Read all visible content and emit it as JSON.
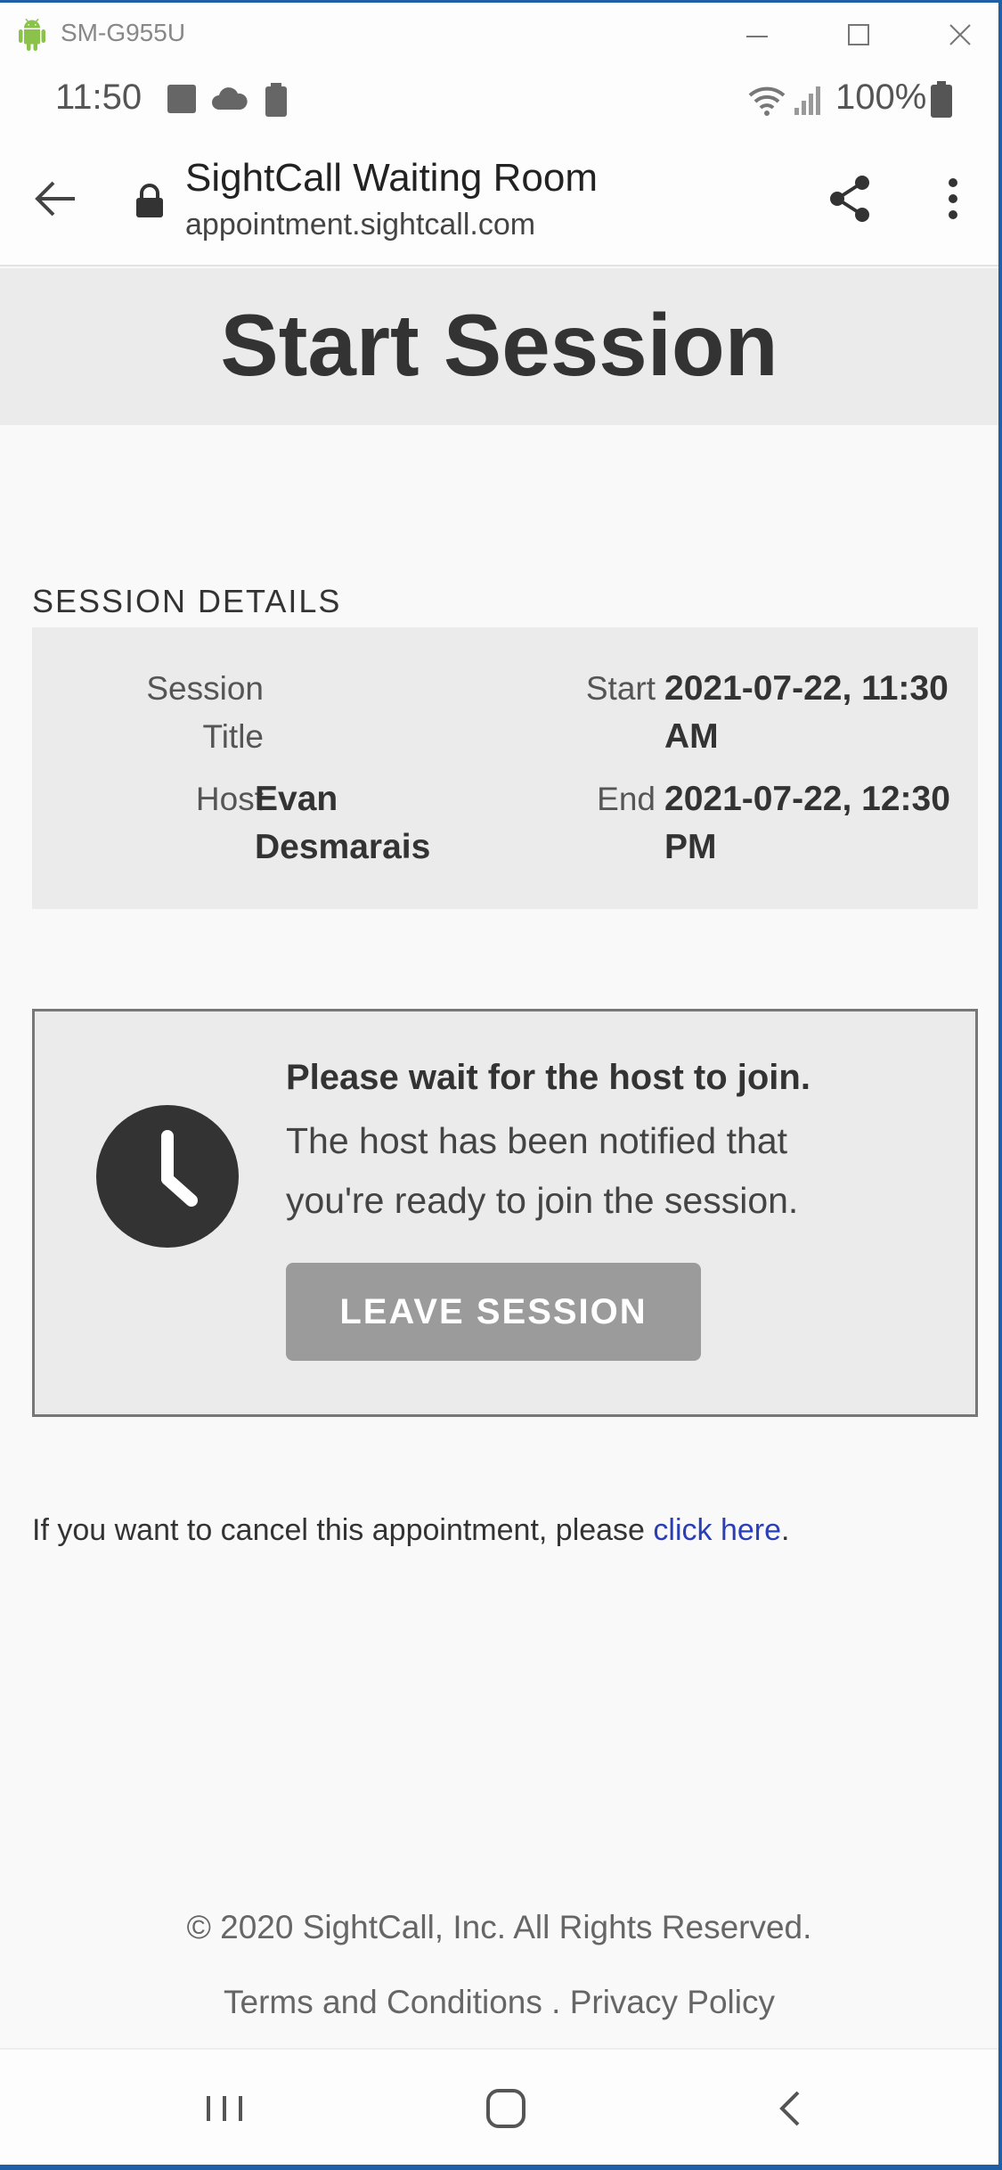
{
  "emulator": {
    "device_name": "SM-G955U"
  },
  "status_bar": {
    "time": "11:50",
    "battery": "100%"
  },
  "browser": {
    "page_title": "SightCall Waiting Room",
    "url": "appointment.sightcall.com"
  },
  "page": {
    "title": "Start Session",
    "section_label": "SESSION DETAILS",
    "details": {
      "session_title_label": "Session Title",
      "host_label": "Host",
      "host_value": "Evan Desmarais",
      "start_label": "Start",
      "start_value": "2021-07-22, 11:30 AM",
      "end_label": "End",
      "end_value": "2021-07-22, 12:30 PM"
    },
    "wait": {
      "heading": "Please wait for the host to join.",
      "message": "The host has been notified that you're ready to join the session.",
      "leave_button": "LEAVE SESSION"
    },
    "cancel": {
      "text": "If you want to cancel this appointment, please ",
      "link": "click here",
      "suffix": "."
    },
    "footer": {
      "copyright": "© 2020 SightCall, Inc. All Rights Reserved.",
      "terms": "Terms and Conditions",
      "separator": " . ",
      "privacy": "Privacy Policy"
    }
  },
  "icons": {
    "android": "android-icon",
    "minimize": "minimize-icon",
    "maximize": "maximize-icon",
    "close": "close-icon",
    "back": "arrow-left-icon",
    "lock": "lock-icon",
    "share": "share-icon",
    "more": "more-vertical-icon",
    "clock": "clock-icon",
    "nav_recent": "recent-apps-icon",
    "nav_home": "home-icon",
    "nav_back": "nav-back-icon"
  },
  "colors": {
    "link": "#2a3fb5",
    "button": "#9b9b9b",
    "panel": "#ebebeb",
    "frame": "#1f5fa8"
  }
}
